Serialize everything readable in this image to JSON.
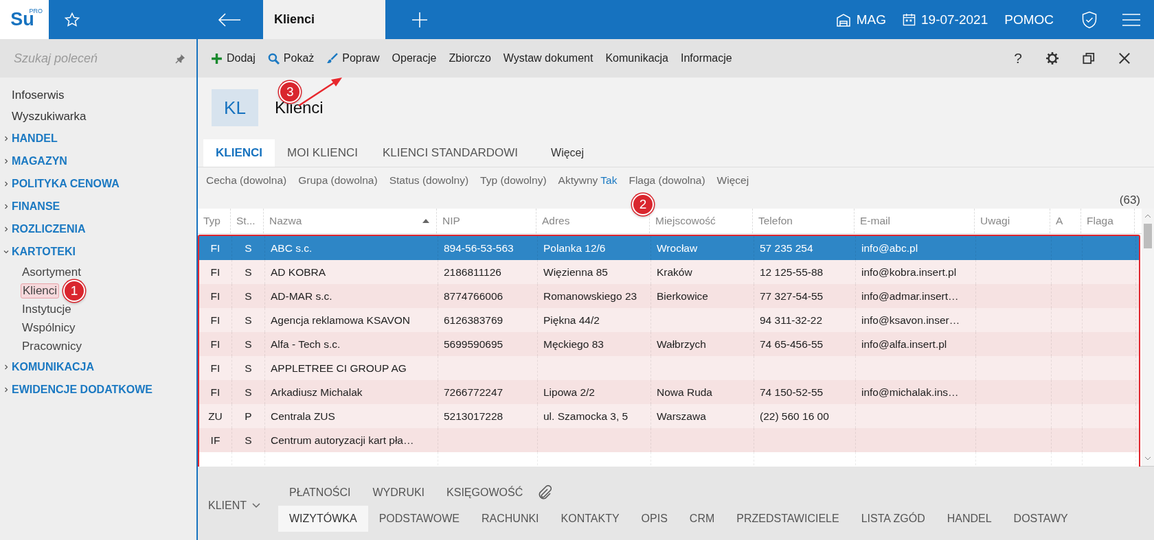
{
  "topbar": {
    "logo": "Su",
    "logo_badge": "PRO",
    "tab": "Klienci",
    "warehouse": "MAG",
    "date": "19-07-2021",
    "help": "POMOC"
  },
  "sidebar": {
    "search": {
      "placeholder": "Szukaj poleceń"
    },
    "items": [
      {
        "label": "Infoserwis",
        "kind": "link"
      },
      {
        "label": "Wyszukiwarka",
        "kind": "link"
      },
      {
        "label": "HANDEL",
        "kind": "group",
        "expanded": false
      },
      {
        "label": "MAGAZYN",
        "kind": "group",
        "expanded": false
      },
      {
        "label": "POLITYKA CENOWA",
        "kind": "group",
        "expanded": false
      },
      {
        "label": "FINANSE",
        "kind": "group",
        "expanded": false
      },
      {
        "label": "ROZLICZENIA",
        "kind": "group",
        "expanded": false
      },
      {
        "label": "KARTOTEKI",
        "kind": "group",
        "expanded": true,
        "children": [
          {
            "label": "Asortyment",
            "selected": false
          },
          {
            "label": "Klienci",
            "selected": true,
            "callout": "1"
          },
          {
            "label": "Instytucje",
            "selected": false
          },
          {
            "label": "Wspólnicy",
            "selected": false
          },
          {
            "label": "Pracownicy",
            "selected": false
          }
        ]
      },
      {
        "label": "KOMUNIKACJA",
        "kind": "group",
        "expanded": false
      },
      {
        "label": "EWIDENCJE DODATKOWE",
        "kind": "group",
        "expanded": false
      }
    ]
  },
  "toolbar": {
    "items": [
      {
        "label": "Dodaj"
      },
      {
        "label": "Pokaż"
      },
      {
        "label": "Popraw",
        "callout": "3"
      },
      {
        "label": "Operacje"
      },
      {
        "label": "Zbiorczo"
      },
      {
        "label": "Wystaw dokument"
      },
      {
        "label": "Komunikacja"
      },
      {
        "label": "Informacje"
      }
    ],
    "help": "?"
  },
  "header": {
    "badge": "KL",
    "title": "Klienci"
  },
  "tabs": [
    {
      "label": "KLIENCI",
      "selected": true
    },
    {
      "label": "MOI KLIENCI",
      "selected": false
    },
    {
      "label": "KLIENCI STANDARDOWI",
      "selected": false
    },
    {
      "label": "Więcej",
      "selected": false
    }
  ],
  "filters": [
    {
      "label": "Cecha (dowolna)"
    },
    {
      "label": "Grupa (dowolna)"
    },
    {
      "label": "Status (dowolny)"
    },
    {
      "label": "Typ (dowolny)"
    },
    {
      "label": "Aktywny",
      "value": "Tak"
    },
    {
      "label": "Flaga (dowolna)"
    },
    {
      "label": "Więcej"
    }
  ],
  "count": "(63)",
  "table": {
    "columns": [
      {
        "label": "Typ",
        "sorted": false
      },
      {
        "label": "St...",
        "sorted": false
      },
      {
        "label": "Nazwa",
        "sorted": true
      },
      {
        "label": "NIP",
        "sorted": false
      },
      {
        "label": "Adres",
        "sorted": false
      },
      {
        "label": "Miejscowość",
        "sorted": false,
        "callout": "2"
      },
      {
        "label": "Telefon",
        "sorted": false
      },
      {
        "label": "E-mail",
        "sorted": false
      },
      {
        "label": "Uwagi",
        "sorted": false
      },
      {
        "label": "A",
        "sorted": false
      },
      {
        "label": "Flaga",
        "sorted": false
      }
    ],
    "rows": [
      {
        "selected": true,
        "cells": [
          "FI",
          "S",
          "ABC s.c.",
          "894-56-53-563",
          "Polanka  12/6",
          "Wrocław",
          "57 235 254",
          "info@abc.pl",
          "",
          "",
          ""
        ]
      },
      {
        "selected": false,
        "cells": [
          "FI",
          "S",
          "AD KOBRA",
          "2186811126",
          "Więzienna  85",
          "Kraków",
          "12 125-55-88",
          "info@kobra.insert.pl",
          "",
          "",
          ""
        ]
      },
      {
        "selected": false,
        "cells": [
          "FI",
          "S",
          "AD-MAR s.c.",
          "8774766006",
          "Romanowskiego 23",
          "Bierkowice",
          "77 327-54-55",
          "info@admar.insert…",
          "",
          "",
          ""
        ]
      },
      {
        "selected": false,
        "cells": [
          "FI",
          "S",
          "Agencja reklamowa KSAVON",
          "6126383769",
          "Piękna  44/2",
          "",
          "94 311-32-22",
          "info@ksavon.inser…",
          "",
          "",
          ""
        ]
      },
      {
        "selected": false,
        "cells": [
          "FI",
          "S",
          "Alfa - Tech s.c.",
          "5699590695",
          "Męckiego  83",
          "Wałbrzych",
          "74 65-456-55",
          "info@alfa.insert.pl",
          "",
          "",
          ""
        ]
      },
      {
        "selected": false,
        "cells": [
          "FI",
          "S",
          "APPLETREE CI GROUP AG",
          "",
          "",
          "",
          "",
          "",
          "",
          "",
          ""
        ]
      },
      {
        "selected": false,
        "cells": [
          "FI",
          "S",
          "Arkadiusz Michalak",
          "7266772247",
          "Lipowa  2/2",
          "Nowa Ruda",
          "74 150-52-55",
          "info@michalak.ins…",
          "",
          "",
          ""
        ]
      },
      {
        "selected": false,
        "cells": [
          "ZU",
          "P",
          "Centrala ZUS",
          "5213017228",
          "ul. Szamocka 3, 5",
          "Warszawa",
          "(22) 560 16 00",
          "",
          "",
          "",
          ""
        ]
      },
      {
        "selected": false,
        "cells": [
          "IF",
          "S",
          "Centrum autoryzacji kart pła…",
          "",
          "",
          "",
          "",
          "",
          "",
          "",
          ""
        ]
      }
    ]
  },
  "bottom_panel": {
    "menu": "KLIENT",
    "upper_tabs": [
      "PŁATNOŚCI",
      "WYDRUKI",
      "KSIĘGOWOŚĆ"
    ],
    "tabs": [
      {
        "label": "WIZYTÓWKA",
        "selected": true
      },
      {
        "label": "PODSTAWOWE",
        "selected": false
      },
      {
        "label": "RACHUNKI",
        "selected": false
      },
      {
        "label": "KONTAKTY",
        "selected": false
      },
      {
        "label": "OPIS",
        "selected": false
      },
      {
        "label": "CRM",
        "selected": false
      },
      {
        "label": "PRZEDSTAWICIELE",
        "selected": false
      },
      {
        "label": "LISTA ZGÓD",
        "selected": false
      },
      {
        "label": "HANDEL",
        "selected": false
      },
      {
        "label": "DOSTAWY",
        "selected": false
      }
    ]
  }
}
